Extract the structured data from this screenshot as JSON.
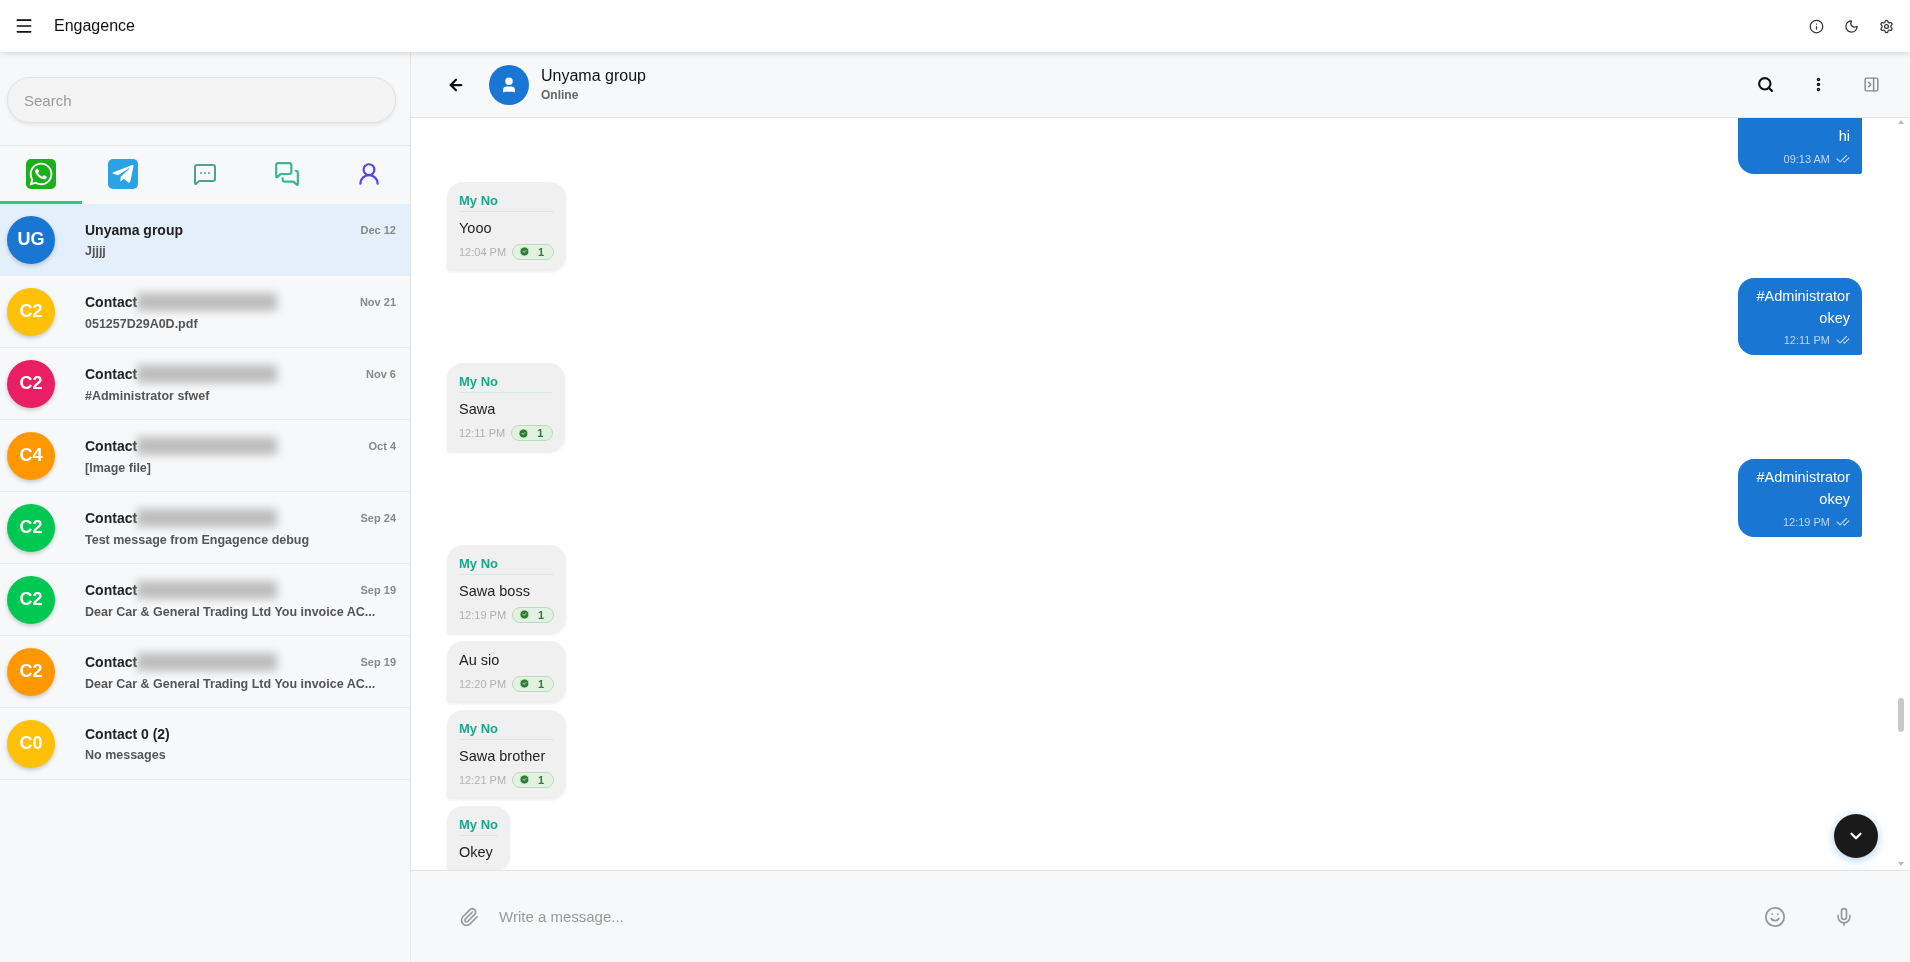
{
  "app_bar": {
    "title": "Engagence"
  },
  "sidebar": {
    "search": {
      "placeholder": "Search"
    },
    "channel_tabs": [
      {
        "kind": "whatsapp",
        "selected": true
      },
      {
        "kind": "telegram",
        "selected": false
      },
      {
        "kind": "sms",
        "selected": false
      },
      {
        "kind": "chat",
        "selected": false
      },
      {
        "kind": "account",
        "selected": false
      }
    ],
    "conversations": [
      {
        "initials": "UG",
        "color": "#1976d2",
        "name": "Unyama group",
        "blurred": false,
        "preview": "Jjjjj",
        "date": "Dec 12",
        "selected": true
      },
      {
        "initials": "C2",
        "color": "#ffc107",
        "name": "Contact",
        "blurred": true,
        "preview": "051257D29A0D.pdf",
        "date": "Nov 21",
        "selected": false
      },
      {
        "initials": "C2",
        "color": "#e91e63",
        "name": "Contact",
        "blurred": true,
        "preview": "#Administrator sfwef",
        "date": "Nov 6",
        "selected": false
      },
      {
        "initials": "C4",
        "color": "#ff9800",
        "name": "Contact",
        "blurred": true,
        "preview": "[Image file]",
        "date": "Oct 4",
        "selected": false
      },
      {
        "initials": "C2",
        "color": "#00c853",
        "name": "Contact",
        "blurred": true,
        "preview": "Test message from Engagence debug",
        "date": "Sep 24",
        "selected": false
      },
      {
        "initials": "C2",
        "color": "#00c853",
        "name": "Contact",
        "blurred": true,
        "preview": "Dear Car & General Trading Ltd You invoice AC...",
        "date": "Sep 19",
        "selected": false
      },
      {
        "initials": "C2",
        "color": "#ff9800",
        "name": "Contact",
        "blurred": true,
        "preview": "Dear Car & General Trading Ltd You invoice AC...",
        "date": "Sep 19",
        "selected": false
      },
      {
        "initials": "C0",
        "color": "#ffc107",
        "name": "Contact 0 (2)",
        "blurred": false,
        "preview": "No messages",
        "selected": false
      }
    ]
  },
  "chat": {
    "title": "Unyama group",
    "status": "Online",
    "messages": [
      {
        "kind": "out",
        "text": "hi",
        "time": "09:13 AM"
      },
      {
        "kind": "in",
        "sender": "My No",
        "text": "Yooo",
        "time": "12:04 PM",
        "count": "1"
      },
      {
        "kind": "out",
        "text": "#Administrator okey",
        "time": "12:11 PM"
      },
      {
        "kind": "in",
        "sender": "My No",
        "text": "Sawa",
        "time": "12:11 PM",
        "count": "1"
      },
      {
        "kind": "out",
        "text": "#Administrator okey",
        "time": "12:19 PM"
      },
      {
        "kind": "in",
        "sender": "My No",
        "text": "Sawa boss",
        "time": "12:19 PM",
        "count": "1"
      },
      {
        "kind": "in",
        "text": "Au sio",
        "time": "12:20 PM",
        "count": "1"
      },
      {
        "kind": "in",
        "sender": "My No",
        "text": "Sawa brother",
        "time": "12:21 PM",
        "count": "1"
      },
      {
        "kind": "in",
        "sender": "My No",
        "text": "Okey"
      }
    ],
    "composer": {
      "placeholder": "Write a message..."
    }
  }
}
